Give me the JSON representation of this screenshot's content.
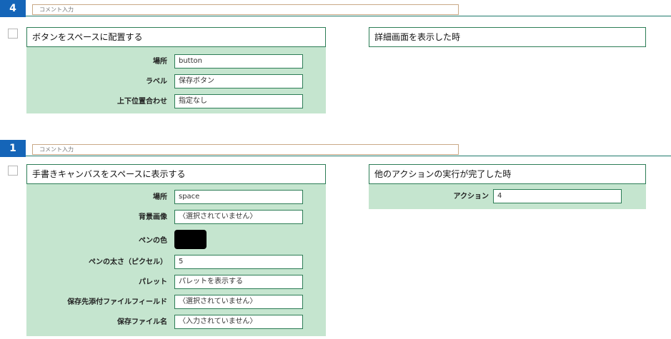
{
  "block1": {
    "number": "4",
    "comment_placeholder": "コメント入力",
    "action": {
      "title": "ボタンをスペースに配置する",
      "rows": [
        {
          "label": "場所",
          "value": "button"
        },
        {
          "label": "ラベル",
          "value": "保存ボタン"
        },
        {
          "label": "上下位置合わせ",
          "value": "指定なし"
        }
      ]
    },
    "trigger": {
      "title": "詳細画面を表示した時"
    }
  },
  "block2": {
    "number": "1",
    "comment_placeholder": "コメント入力",
    "action": {
      "title": "手書きキャンバスをスペースに表示する",
      "rows": [
        {
          "label": "場所",
          "value": "space"
        },
        {
          "label": "背景画像",
          "value": "〈選択されていません〉"
        },
        {
          "label": "ペンの色",
          "color": "#000000"
        },
        {
          "label": "ペンの太さ（ピクセル）",
          "value": "5"
        },
        {
          "label": "パレット",
          "value": "パレットを表示する"
        },
        {
          "label": "保存先添付ファイルフィールド",
          "value": "〈選択されていません〉"
        },
        {
          "label": "保存ファイル名",
          "value": "〈入力されていません〉"
        }
      ]
    },
    "trigger": {
      "title": "他のアクションの実行が完了した時",
      "rows": [
        {
          "label": "アクション",
          "value": "4"
        }
      ]
    }
  },
  "colors": {
    "number_badge": "#1565b8",
    "card_background": "#c5e5cf",
    "card_border": "#2d7d56",
    "comment_border": "#c9a987"
  },
  "icons": {
    "checkbox": "checkbox-unchecked-icon"
  }
}
